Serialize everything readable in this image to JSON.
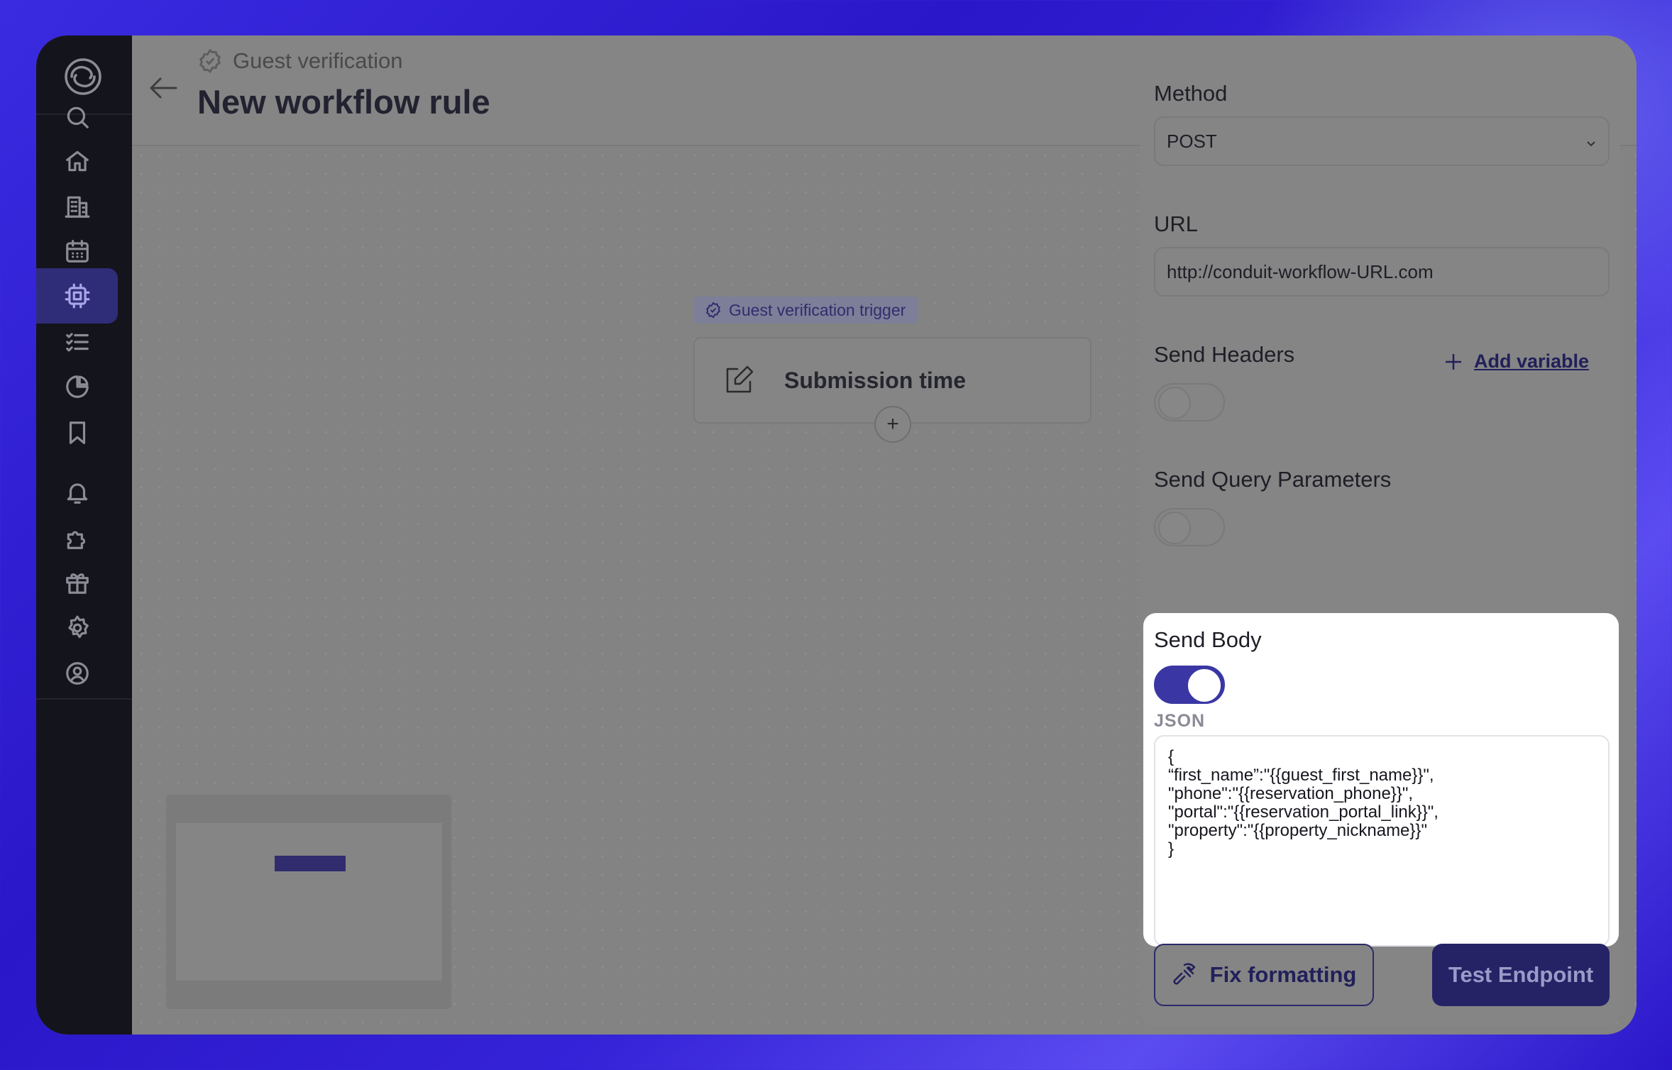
{
  "header": {
    "breadcrumb": "Guest verification",
    "title": "New workflow rule"
  },
  "sidebar": {
    "items": [
      {
        "icon": "search-icon"
      },
      {
        "icon": "home-icon"
      },
      {
        "icon": "building-icon"
      },
      {
        "icon": "calendar-icon"
      },
      {
        "icon": "cpu-chip-icon",
        "active": true
      },
      {
        "icon": "checklist-icon"
      },
      {
        "icon": "pie-chart-icon"
      },
      {
        "icon": "bookmark-icon"
      },
      {
        "icon": "bell-icon"
      },
      {
        "icon": "puzzle-icon"
      },
      {
        "icon": "gift-icon"
      },
      {
        "icon": "gear-icon"
      },
      {
        "icon": "user-circle-icon"
      }
    ]
  },
  "canvas": {
    "trigger_tag": "Guest verification trigger",
    "trigger_node": "Submission time",
    "add_node": "+"
  },
  "panel": {
    "method": {
      "label": "Method",
      "value": "POST"
    },
    "url": {
      "label": "URL",
      "value": "http://conduit-workflow-URL.com"
    },
    "send_headers": {
      "label": "Send Headers",
      "enabled": false,
      "add_variable": "Add variable"
    },
    "send_query": {
      "label": "Send Query Parameters",
      "enabled": false
    },
    "send_body": {
      "label": "Send Body",
      "enabled": true,
      "format_label": "JSON",
      "json": "{\n“first_name”:\"{{guest_first_name}}\",\n\"phone\":\"{{reservation_phone}}\",\n\"portal\":\"{{reservation_portal_link}}\",\n\"property\":\"{{property_nickname}}\"\n}"
    },
    "fix_formatting": "Fix formatting",
    "test_endpoint": "Test Endpoint"
  },
  "colors": {
    "accent": "#3a37a4",
    "sidebar_bg": "#14141c",
    "overlay": "#808080"
  }
}
